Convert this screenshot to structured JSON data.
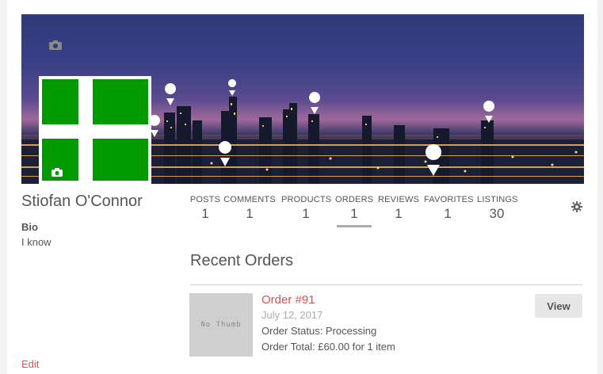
{
  "profile": {
    "name": "Stiofan O'Connor",
    "bio_label": "Bio",
    "bio_text": "I know",
    "edit_label": "Edit"
  },
  "cover": {
    "camera_icon": "camera-icon"
  },
  "stats": [
    {
      "label": "POSTS",
      "value": "1"
    },
    {
      "label": "COMMENTS",
      "value": "1"
    },
    {
      "label": "PRODUCTS",
      "value": "1"
    },
    {
      "label": "ORDERS",
      "value": "1",
      "active": true
    },
    {
      "label": "REVIEWS",
      "value": "1"
    },
    {
      "label": "FAVORITES",
      "value": "1"
    },
    {
      "label": "LISTINGS",
      "value": "30"
    }
  ],
  "orders": {
    "section_title": "Recent Orders",
    "items": [
      {
        "title": "Order #91",
        "date": "July 12, 2017",
        "status": "Order Status: Processing",
        "total": "Order Total: £60.00 for 1 item",
        "thumb_text": "No Thumb",
        "view_label": "View"
      }
    ]
  },
  "colors": {
    "accent": "#d9534f",
    "avatar_green": "#009900"
  }
}
